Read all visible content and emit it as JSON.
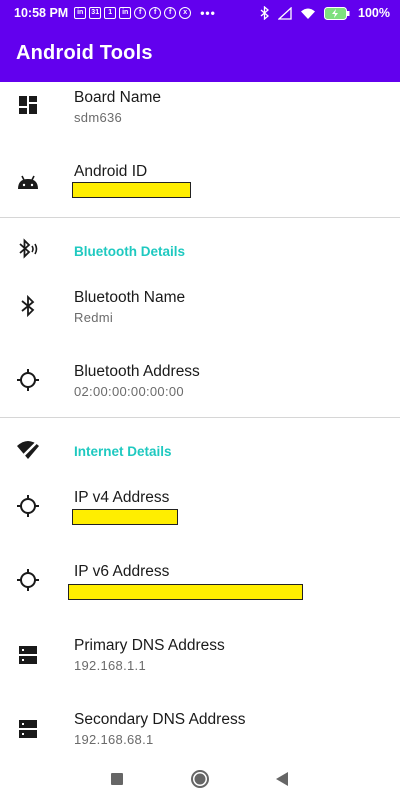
{
  "status_bar": {
    "time": "10:58 PM",
    "notification_icons": [
      "linkedin-icon",
      "calendar-icon",
      "calendar-icon",
      "linkedin-icon",
      "facebook-icon",
      "facebook-icon",
      "facebook-icon",
      "xbox-icon",
      "more-icon"
    ],
    "calendar_day": "31",
    "calendar_day_2": "1",
    "battery": "100%"
  },
  "app_bar": {
    "title": "Android Tools"
  },
  "rows": {
    "board_name": {
      "title": "Board Name",
      "value": "sdm636",
      "icon": "dashboard-icon"
    },
    "android_id": {
      "title": "Android ID",
      "icon": "android-icon"
    },
    "bluetooth_section": {
      "title": "Bluetooth Details",
      "icon": "bluetooth-audio-icon"
    },
    "bluetooth_name": {
      "title": "Bluetooth Name",
      "value": "Redmi",
      "icon": "bluetooth-icon"
    },
    "bluetooth_address": {
      "title": "Bluetooth Address",
      "value": "02:00:00:00:00:00",
      "icon": "crosshair-icon"
    },
    "internet_section": {
      "title": "Internet Details",
      "icon": "wifi-off-icon"
    },
    "ipv4": {
      "title": "IP v4 Address",
      "icon": "crosshair-icon"
    },
    "ipv6": {
      "title": "IP v6 Address",
      "icon": "crosshair-icon"
    },
    "primary_dns": {
      "title": "Primary DNS Address",
      "value": "192.168.1.1",
      "icon": "dns-icon"
    },
    "secondary_dns": {
      "title": "Secondary DNS Address",
      "value": "192.168.68.1",
      "icon": "dns-icon"
    }
  },
  "colors": {
    "primary": "#6200EE",
    "accent": "#1FC9C0",
    "redaction": "#FFEE00"
  }
}
